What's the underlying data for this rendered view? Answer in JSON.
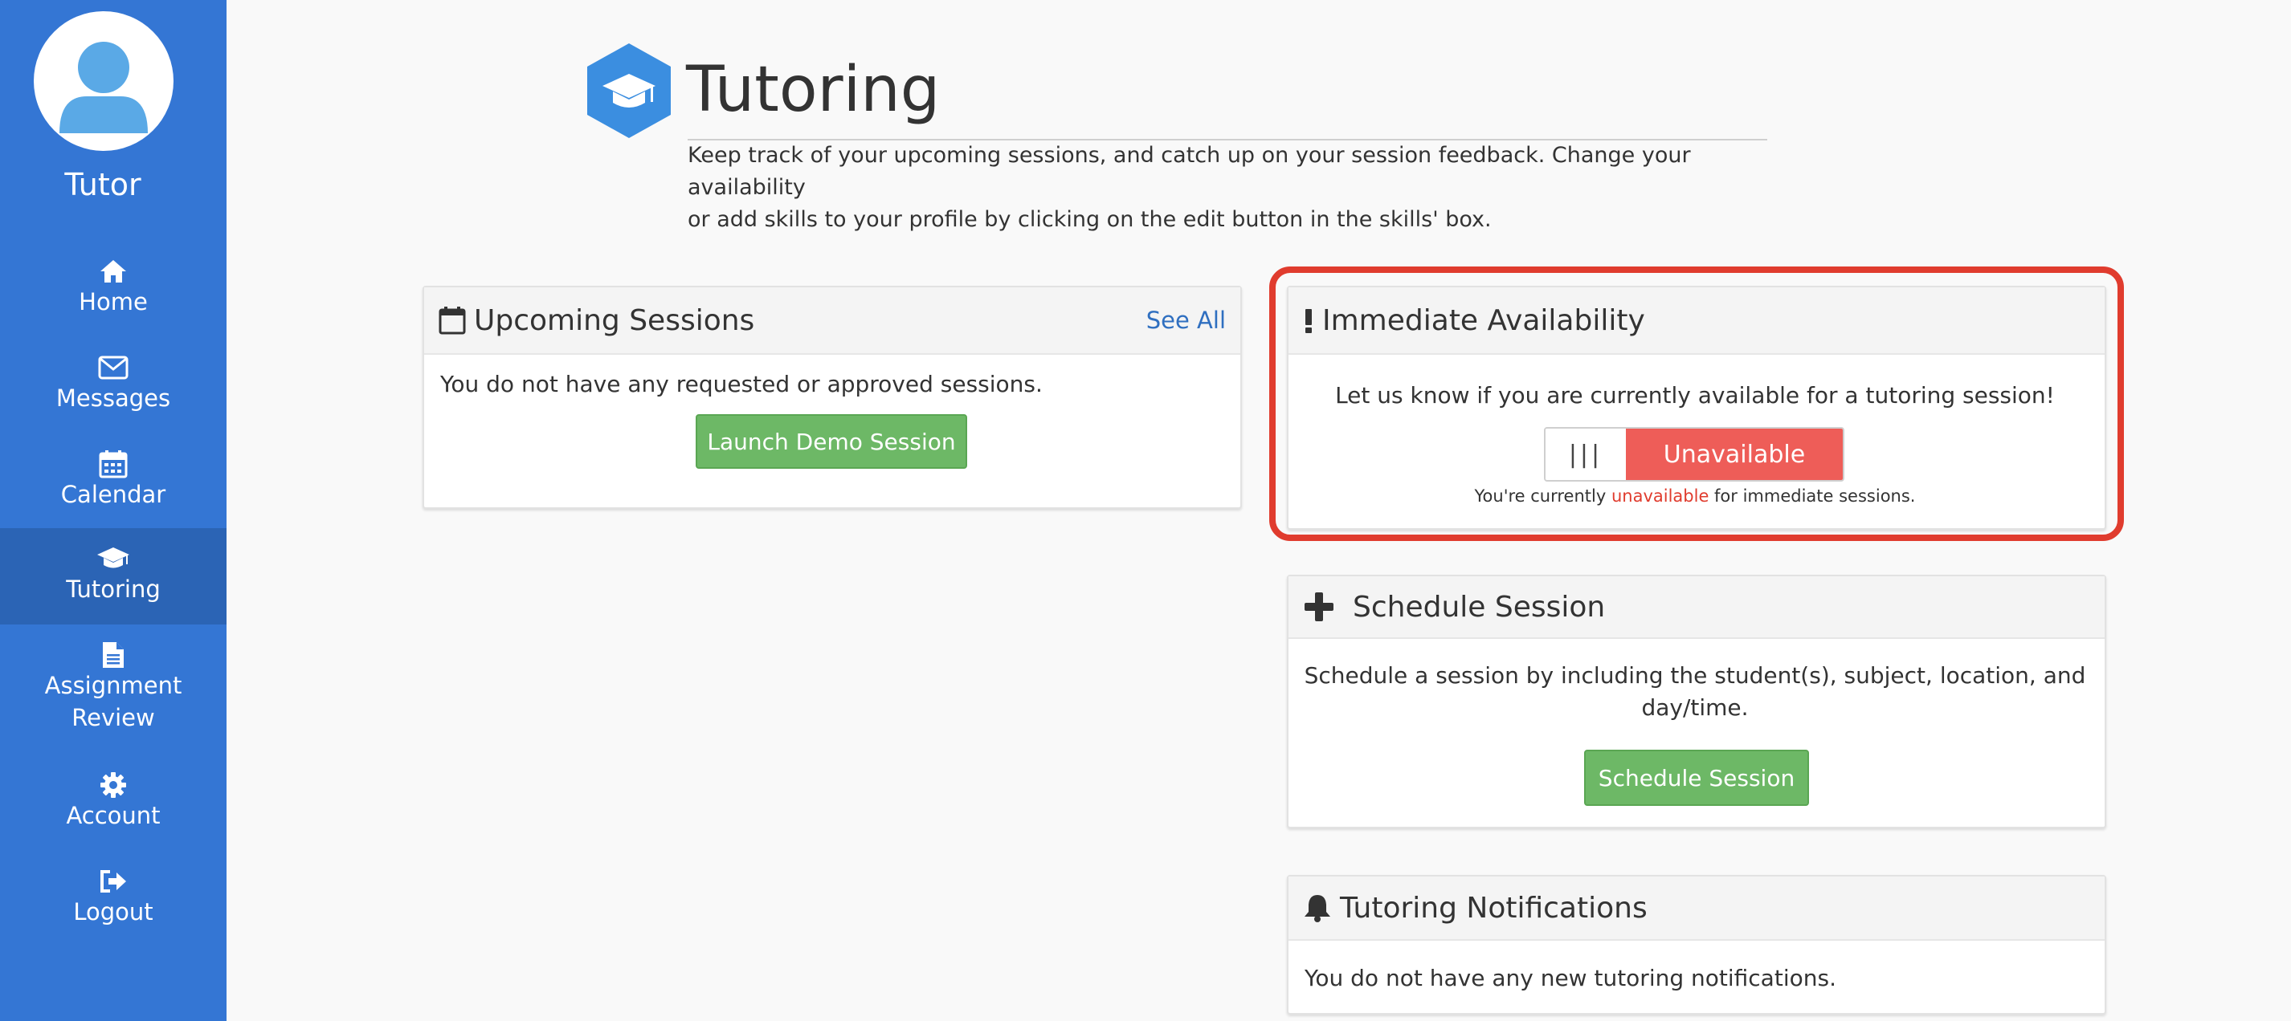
{
  "sidebar": {
    "user_label": "Tutor",
    "items": [
      {
        "label": "Home",
        "icon": "home-icon"
      },
      {
        "label": "Messages",
        "icon": "envelope-icon"
      },
      {
        "label": "Calendar",
        "icon": "calendar-icon"
      },
      {
        "label": "Tutoring",
        "icon": "graduation-cap-icon",
        "active": true
      },
      {
        "label_line1": "Assignment",
        "label_line2": "Review",
        "icon": "document-icon"
      },
      {
        "label": "Account",
        "icon": "gear-icon"
      },
      {
        "label": "Logout",
        "icon": "sign-out-icon"
      }
    ]
  },
  "header": {
    "title": "Tutoring",
    "description_line1": "Keep track of your upcoming sessions, and catch up on your session feedback. Change your availability",
    "description_line2": "or add skills to your profile by clicking on the edit button in the skills' box."
  },
  "upcoming": {
    "title": "Upcoming Sessions",
    "see_all": "See All",
    "empty_text": "You do not have any requested or approved sessions.",
    "button": "Launch Demo Session"
  },
  "availability": {
    "title": "Immediate Availability",
    "prompt": "Let us know if you are currently available for a tutoring session!",
    "toggle_handle": "|||",
    "toggle_state": "Unavailable",
    "status_prefix": "You're currently ",
    "status_word": "unavailable",
    "status_suffix": " for immediate sessions."
  },
  "schedule": {
    "title": "Schedule Session",
    "text_line1": "Schedule a session by including the student(s), subject, location, and",
    "text_line2": "day/time.",
    "button": "Schedule Session"
  },
  "notifications": {
    "title": "Tutoring Notifications",
    "empty_text": "You do not have any new tutoring notifications."
  },
  "colors": {
    "sidebar": "#3476d4",
    "sidebar_active": "#2b64b5",
    "green_button": "#6db866",
    "unavailable_red": "#ee5d58",
    "highlight": "#e03c2e",
    "link_blue": "#2f6fc0"
  }
}
